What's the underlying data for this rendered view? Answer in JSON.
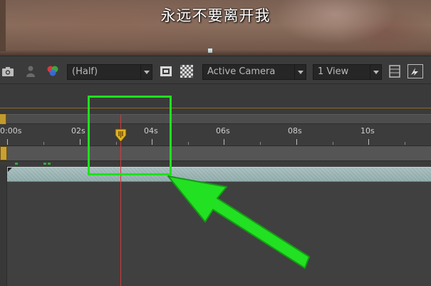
{
  "preview": {
    "subtitle": "永远不要离开我"
  },
  "toolbar": {
    "items": [
      {
        "name": "snapshot-icon"
      },
      {
        "name": "show-snapshot-icon"
      },
      {
        "name": "color-channels-icon"
      },
      {
        "name": "resolution-dropdown",
        "value": "(Half)"
      },
      {
        "name": "region-of-interest-icon"
      },
      {
        "name": "transparency-grid-icon"
      },
      {
        "name": "camera-dropdown",
        "value": "Active Camera"
      },
      {
        "name": "view-layout-dropdown",
        "value": "1 View"
      },
      {
        "name": "pixel-aspect-icon"
      },
      {
        "name": "fast-previews-icon"
      }
    ],
    "resolution": "(Half)",
    "camera": "Active Camera",
    "views": "1 View"
  },
  "timeline": {
    "ruler_labels": [
      "0:00s",
      "02s",
      "04s",
      "06s",
      "08s",
      "10s"
    ],
    "current_time_seconds": 3.1,
    "work_area_color": "#c39a2c",
    "playhead_color": "#d23a3a",
    "layer_bar_color": "#a3bdbc"
  },
  "annotation": {
    "highlight_color": "#20e020"
  }
}
